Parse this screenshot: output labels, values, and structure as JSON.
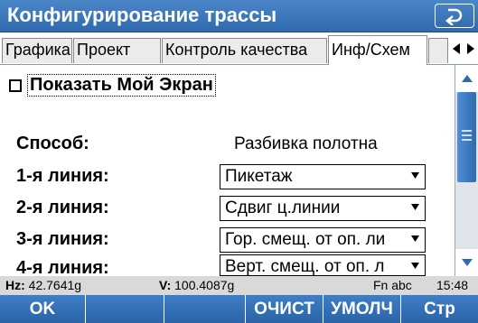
{
  "window": {
    "title": "Конфигурирование трассы"
  },
  "tabs": [
    {
      "label": "Графика",
      "active": false
    },
    {
      "label": "Проект",
      "active": false
    },
    {
      "label": "Контроль качества",
      "active": false
    },
    {
      "label": "Инф/Схем",
      "active": true
    }
  ],
  "content": {
    "show_my_screen": {
      "label": "Показать Мой Экран",
      "checked": false
    },
    "method": {
      "label": "Способ:",
      "value": "Разбивка полотна"
    },
    "lines": [
      {
        "label": "1-я линия:",
        "value": "Пикетаж"
      },
      {
        "label": "2-я линия:",
        "value": "Сдвиг ц.линии"
      },
      {
        "label": "3-я линия:",
        "value": "Гор. смещ. от оп. ли"
      },
      {
        "label": "4-я линия:",
        "value": "Верт. смещ. от оп. л"
      }
    ]
  },
  "status": {
    "hz_label": "Hz:",
    "hz_value": "42.7641g",
    "v_label": "V:",
    "v_value": "100.4087g",
    "input_mode": "Fn abc",
    "time": "15:48"
  },
  "softkeys": [
    {
      "label": "OK"
    },
    {
      "label": ""
    },
    {
      "label": ""
    },
    {
      "label": "ОЧИСТ"
    },
    {
      "label": "УМОЛЧ"
    },
    {
      "label": "Стр"
    }
  ],
  "icons": {
    "back": "back-arrow-icon",
    "tab_left": "triangle-left-icon",
    "tab_right": "triangle-right-icon",
    "scroll_up": "triangle-up-icon",
    "scroll_down": "triangle-down-icon",
    "dropdown": "triangle-down-icon"
  },
  "colors": {
    "title_bar": "#2f6aad",
    "softkey_bar": "#2b63a6",
    "status_bar": "#d9d9d9"
  }
}
